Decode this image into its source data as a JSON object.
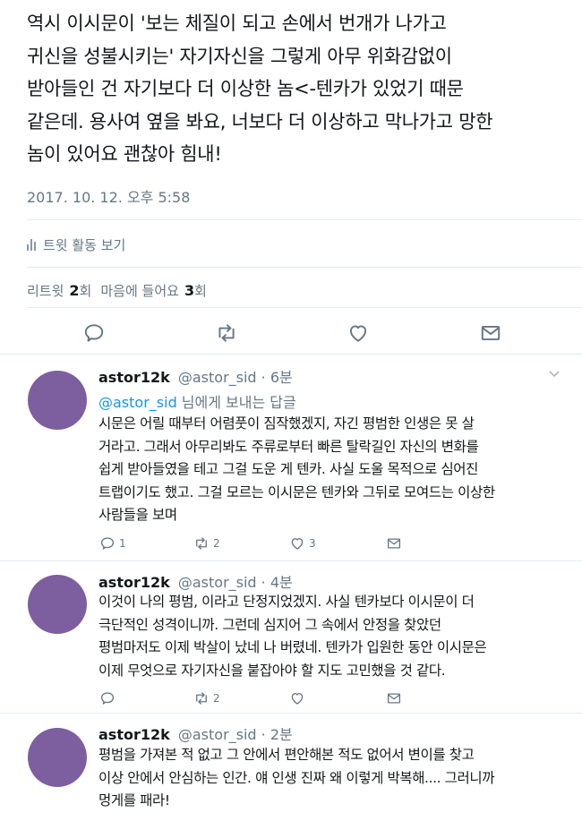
{
  "tweet": {
    "lines": [
      "역시 이시문이 '보는 체질이 되고 손에서 번개가 나가고",
      "귀신을 성불시키는' 자기자신을 그렇게 아무 위화감없이",
      "받아들인 건 자기보다 더 이상한 놈<-텐카가 있었기 때문",
      "같은데. 용사여 옆을 봐요, 너보다 더 이상하고 막나가고 망한",
      "놈이 있어요 괜찮아 힘내!"
    ],
    "timestamp": "2017. 10. 12. 오후 5:58",
    "activity_label": "트윗 활동 보기",
    "stats": {
      "retweet_label": "리트윗",
      "retweet_count": "2",
      "retweet_unit": "회",
      "like_label": "마음에 들어요",
      "like_count": "3",
      "like_unit": "회"
    },
    "actions": {
      "reply_icon": "reply-icon",
      "retweet_icon": "retweet-icon",
      "like_icon": "heart-icon",
      "dm_icon": "envelope-icon"
    }
  },
  "replies": [
    {
      "name": "astor12k",
      "handle": "@astor_sid · 6분",
      "replying_to_handle": "@astor_sid",
      "replying_to_suffix": " 님에게 보내는 답글",
      "lines": [
        "시문은 어릴 때부터 어렴풋이 짐작했겠지, 자긴 평범한 인생은 못 살",
        "거라고. 그래서 아무리봐도 주류로부터 빠른 탈락길인 자신의 변화를",
        "쉽게 받아들였을 테고 그걸 도운 게 텐카. 사실 도울 목적으로 심어진",
        "트랩이기도 했고. 그걸 모르는 이시문은 텐카와 그뒤로 모여드는 이상한",
        "사람들을 보며"
      ],
      "reply_count": "1",
      "retweet_count": "2",
      "like_count": "3"
    },
    {
      "name": "astor12k",
      "handle": "@astor_sid · 4분",
      "lines": [
        "이것이 나의 평범, 이라고 단정지었겠지. 사실 텐카보다 이시문이 더",
        "극단적인 성격이니까. 그런데 심지어 그 속에서 안정을 찾았던",
        "평범마저도 이제 박살이 났네 나 버렸네. 텐카가 입원한 동안 이시문은",
        "이제 무엇으로 자기자신을 붙잡아야 할 지도 고민했을 것 같다."
      ],
      "reply_count": "",
      "retweet_count": "2",
      "like_count": ""
    },
    {
      "name": "astor12k",
      "handle": "@astor_sid · 2분",
      "lines": [
        "평범을 가져본 적 없고 그 안에서 편안해본 적도 없어서 변이를 찾고",
        "이상 안에서 안심하는 인간. 얘 인생 진짜 왜 이렇게 박복해.... 그러니까",
        "멍게를 패라!"
      ]
    }
  ],
  "colors": {
    "accent": "#1b95e0",
    "avatar": "#7d5e9f",
    "secondary_text": "#657786",
    "icon": "#657786",
    "divider": "#e6ecf0"
  }
}
